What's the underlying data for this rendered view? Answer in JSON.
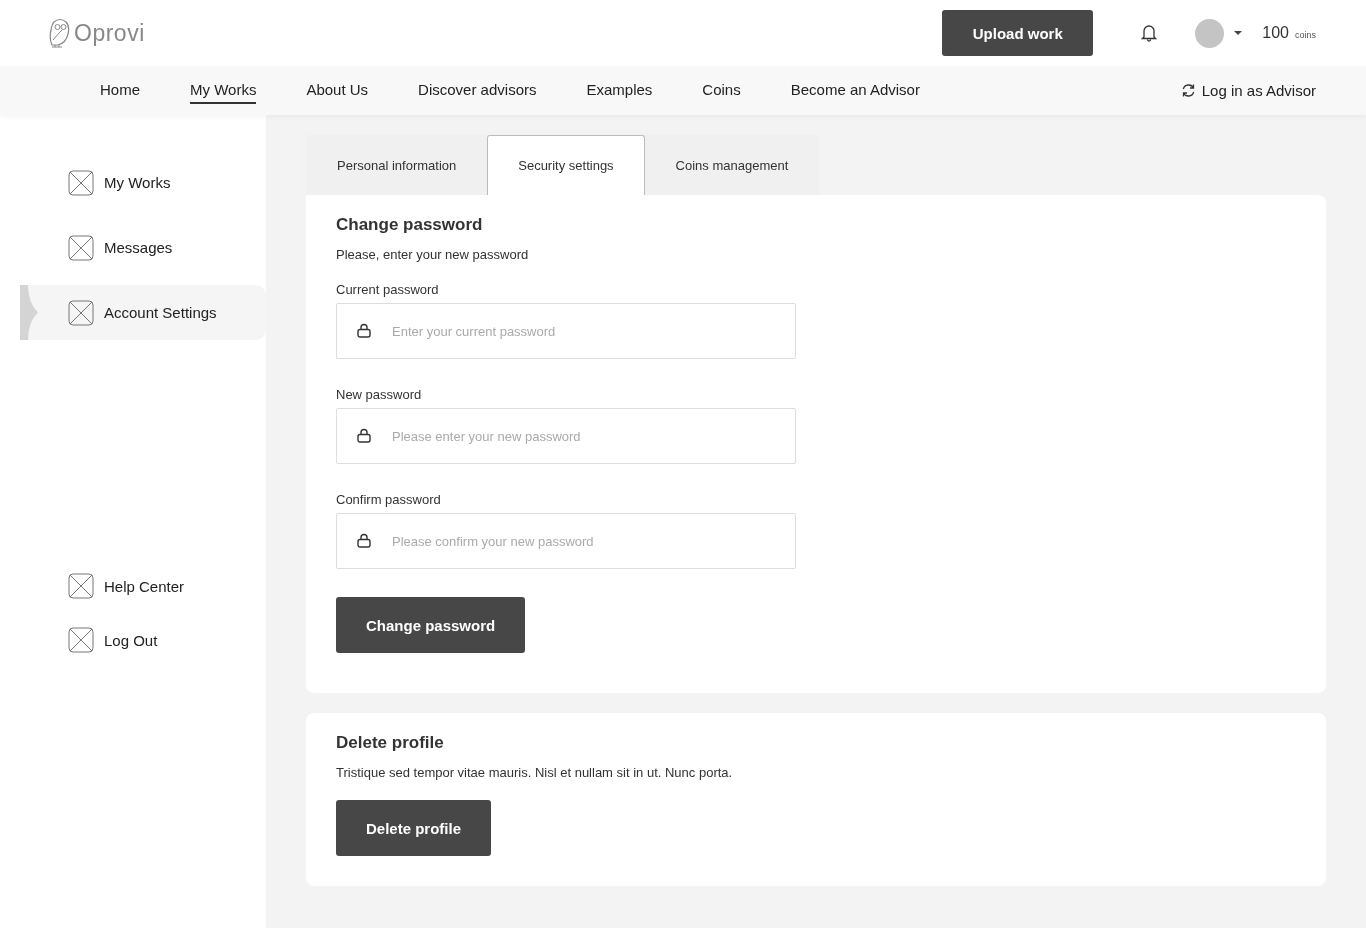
{
  "header": {
    "logo": "Oprovi",
    "upload_button": "Upload work",
    "coins_amount": "100",
    "coins_unit": "coins"
  },
  "nav": {
    "items": [
      {
        "label": "Home",
        "selected": false
      },
      {
        "label": "My Works",
        "selected": true
      },
      {
        "label": "About Us",
        "selected": false
      },
      {
        "label": "Discover advisors",
        "selected": false
      },
      {
        "label": "Examples",
        "selected": false
      },
      {
        "label": "Coins",
        "selected": false
      },
      {
        "label": "Become an Advisor",
        "selected": false
      }
    ],
    "switch_link": "Log in as Advisor"
  },
  "sidebar": {
    "items": [
      {
        "label": "My Works",
        "selected": false
      },
      {
        "label": "Messages",
        "selected": false
      },
      {
        "label": "Account Settings",
        "selected": true
      }
    ],
    "bottom_items": [
      {
        "label": "Help Center",
        "selected": false
      },
      {
        "label": "Log Out",
        "selected": false
      }
    ]
  },
  "tabs": [
    {
      "label": "Personal information",
      "selected": false
    },
    {
      "label": "Security settings",
      "selected": true
    },
    {
      "label": "Coins management",
      "selected": false
    }
  ],
  "change_password": {
    "title": "Change password",
    "subtitle": "Please, enter your new password",
    "fields": [
      {
        "label": "Current password",
        "placeholder": "Enter your current password"
      },
      {
        "label": "New password",
        "placeholder": "Please enter your new password"
      },
      {
        "label": "Confirm password",
        "placeholder": "Please confirm your new password"
      }
    ],
    "button": "Change password"
  },
  "delete_profile": {
    "title": "Delete profile",
    "text": "Tristique sed tempor vitae mauris. Nisl et nullam sit in ut. Nunc porta.",
    "button": "Delete profile"
  }
}
